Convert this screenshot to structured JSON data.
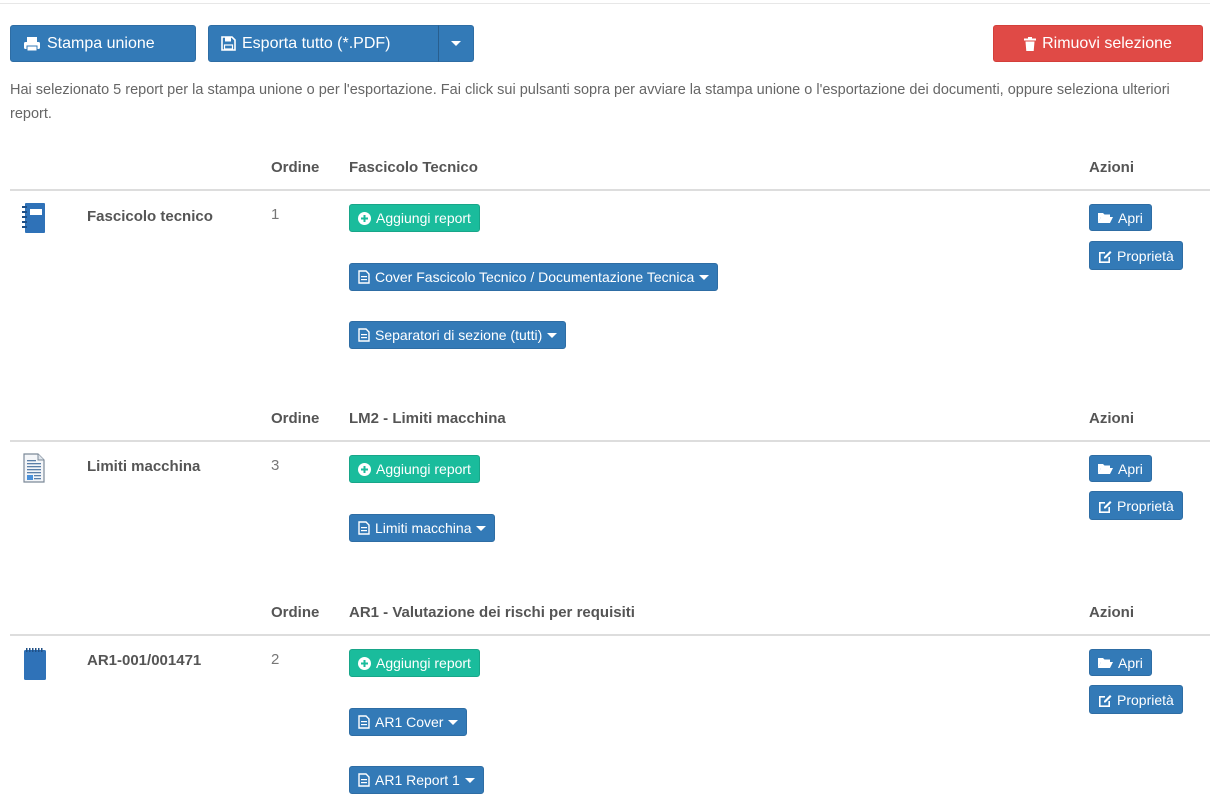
{
  "toolbar": {
    "print_merge_label": "Stampa unione",
    "export_all_label": "Esporta tutto (*.PDF)",
    "remove_selection_label": "Rimuovi selezione"
  },
  "info_text": "Hai selezionato 5 report per la stampa unione o per l'esportazione. Fai click sui pulsanti sopra per avviare la stampa unione o l'esportazione dei documenti, oppure seleziona ulteriori report.",
  "sections": [
    {
      "order_header": "Ordine",
      "title": "Fascicolo Tecnico",
      "actions_header": "Azioni",
      "item_name": "Fascicolo tecnico",
      "order": "1",
      "add_label": "Aggiungi report",
      "reports": [
        "Cover Fascicolo Tecnico / Documentazione Tecnica",
        "Separatori di sezione (tutti)"
      ],
      "open_label": "Apri",
      "props_label": "Proprietà"
    },
    {
      "order_header": "Ordine",
      "title": "LM2 - Limiti macchina",
      "actions_header": "Azioni",
      "item_name": "Limiti macchina",
      "order": "3",
      "add_label": "Aggiungi report",
      "reports": [
        "Limiti macchina"
      ],
      "open_label": "Apri",
      "props_label": "Proprietà"
    },
    {
      "order_header": "Ordine",
      "title": "AR1 - Valutazione dei rischi per requisiti",
      "actions_header": "Azioni",
      "item_name": "AR1-001/001471",
      "order": "2",
      "add_label": "Aggiungi report",
      "reports": [
        "AR1 Cover",
        "AR1 Report 1"
      ],
      "open_label": "Apri",
      "props_label": "Proprietà"
    }
  ],
  "colors": {
    "primary": "#337ab7",
    "danger": "#e04a46",
    "success": "#1abc9c"
  }
}
